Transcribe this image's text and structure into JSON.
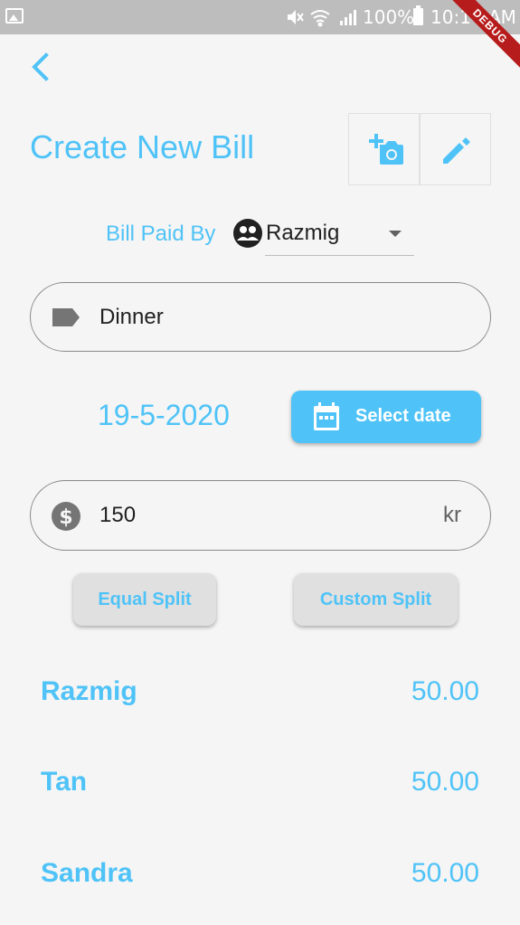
{
  "status_bar": {
    "battery_percent": "100%",
    "time": "10:14 AM",
    "icons": [
      "gallery-icon",
      "mute-icon",
      "wifi-icon",
      "signal-icon",
      "battery-icon"
    ]
  },
  "debug_banner": "DEBUG",
  "header": {
    "title": "Create New Bill",
    "back_icon": "chevron-left-icon",
    "actions": [
      "add-photo-icon",
      "edit-icon"
    ]
  },
  "bill": {
    "paid_by_label": "Bill Paid By",
    "payer": "Razmig",
    "name_value": "Dinner",
    "date": "19-5-2020",
    "select_date_label": "Select date",
    "amount_value": "150",
    "currency": "kr"
  },
  "split": {
    "equal_label": "Equal Split",
    "custom_label": "Custom Split",
    "members": [
      {
        "name": "Razmig",
        "amount": "50.00"
      },
      {
        "name": "Tan",
        "amount": "50.00"
      },
      {
        "name": "Sandra",
        "amount": "50.00"
      }
    ]
  },
  "colors": {
    "accent": "#4fc3f7",
    "background": "#f5f5f5",
    "status_bar": "#bdbdbd",
    "debug_ribbon": "#b71c1c"
  }
}
